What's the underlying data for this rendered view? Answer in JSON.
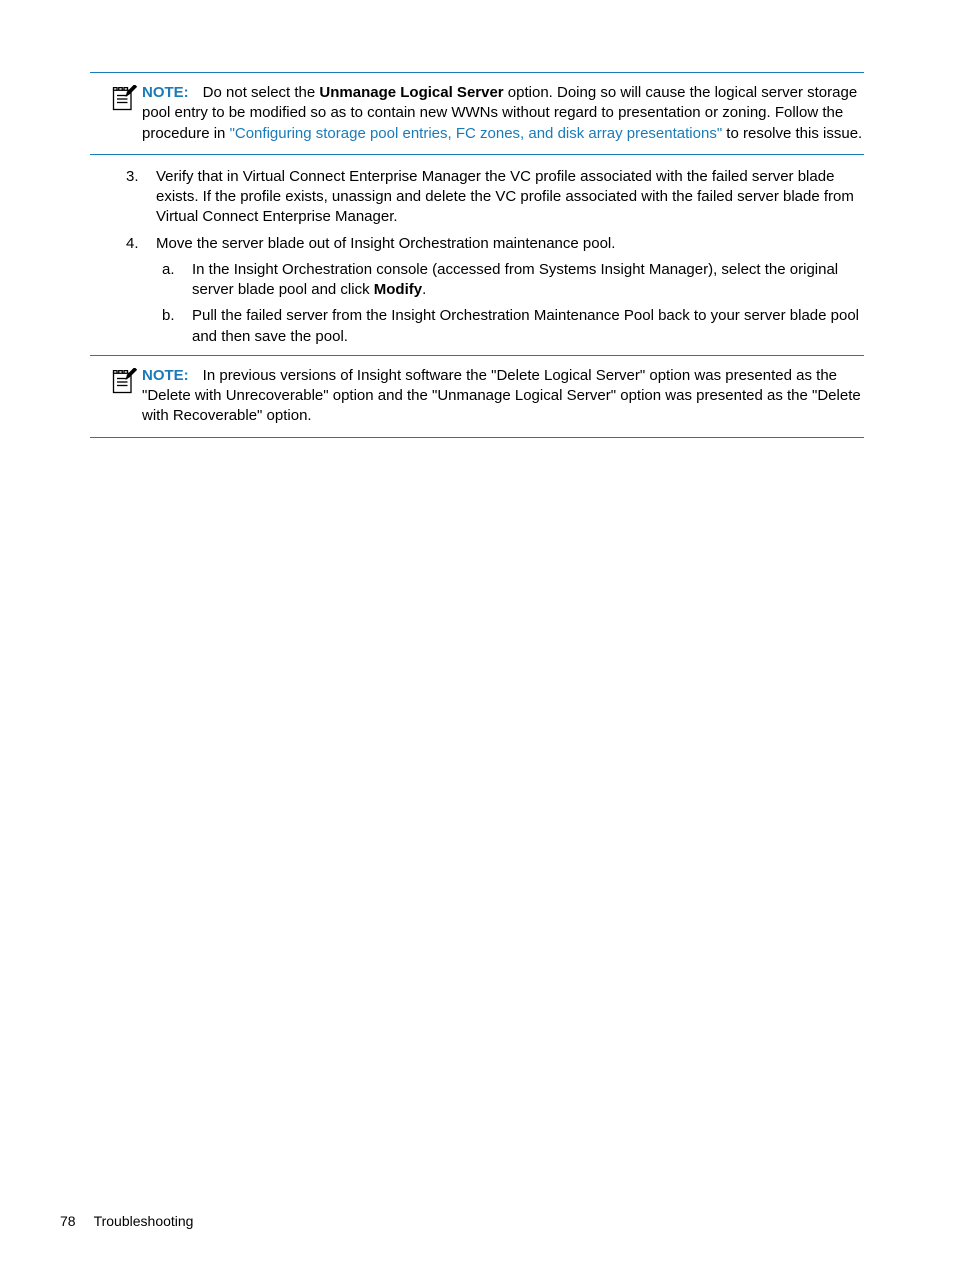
{
  "note1": {
    "label": "NOTE:",
    "text1": "Do not select the ",
    "bold1": "Unmanage Logical Server",
    "text2": " option. Doing so will cause the logical server storage pool entry to be modified so as to contain new WWNs without regard to presentation or zoning. Follow the procedure in ",
    "link": "\"Configuring storage pool entries, FC zones, and disk array presentations\"",
    "text3": " to resolve this issue."
  },
  "list": {
    "item3": {
      "num": "3.",
      "text": "Verify that in Virtual Connect Enterprise Manager the VC profile associated with the failed server blade exists. If the profile exists, unassign and delete the VC profile associated with the failed server blade from Virtual Connect Enterprise Manager."
    },
    "item4": {
      "num": "4.",
      "text": "Move the server blade out of Insight Orchestration maintenance pool.",
      "a": {
        "letter": "a.",
        "text1": "In the Insight Orchestration console (accessed from Systems Insight Manager), select the original server blade pool and click ",
        "bold": "Modify",
        "text2": "."
      },
      "b": {
        "letter": "b.",
        "text": "Pull the failed server from the Insight Orchestration Maintenance Pool back to your server blade pool and then save the pool."
      }
    }
  },
  "note2": {
    "label": "NOTE:",
    "text": "In previous versions of Insight software the \"Delete Logical Server\" option was presented as the \"Delete with Unrecoverable\" option and the \"Unmanage Logical Server\" option was presented as the \"Delete with Recoverable\" option."
  },
  "footer": {
    "page": "78",
    "section": "Troubleshooting"
  }
}
